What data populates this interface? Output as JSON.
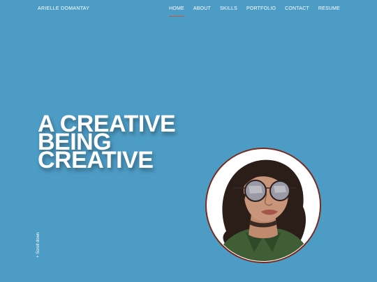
{
  "header": {
    "brand": "ARIELLE DOMANTAY",
    "nav": [
      {
        "label": "HOME",
        "active": true
      },
      {
        "label": "ABOUT"
      },
      {
        "label": "SKILLS"
      },
      {
        "label": "PORTFOLIO"
      },
      {
        "label": "CONTACT"
      },
      {
        "label": "RESUME"
      }
    ]
  },
  "hero": {
    "lines": [
      "A CREATIVE",
      "BEING",
      "CREATIVE"
    ]
  },
  "scroll": {
    "label": "+ Scroll down"
  },
  "colors": {
    "background": "#4d9cc5",
    "accent": "#c45a3c",
    "text": "#ffffff"
  },
  "avatar": {
    "icon": "woman-with-sunglasses-illustration"
  }
}
